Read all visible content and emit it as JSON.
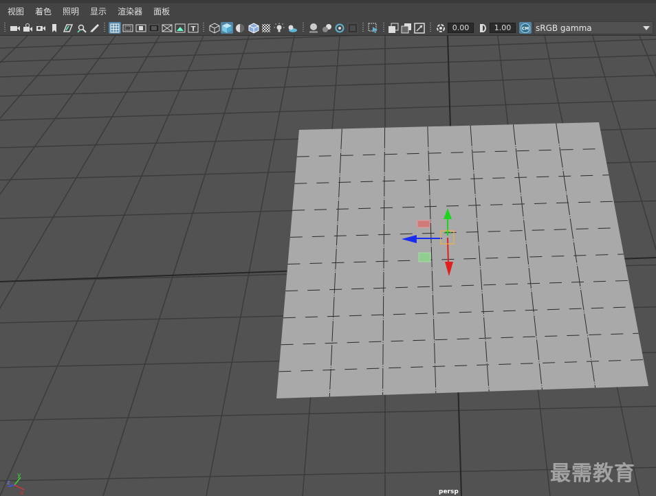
{
  "menu": [
    "视图",
    "着色",
    "照明",
    "显示",
    "渲染器",
    "面板"
  ],
  "toolbar": {
    "exposure_value": "0.00",
    "gamma_value": "1.00",
    "colorspace_value": "sRGB gamma",
    "accent_color": "#5fb3d3",
    "icons": [
      "select-camera-icon",
      "camera-attributes-icon",
      "bookmark-icon",
      "image-plane-icon",
      "2d-pan-zoom-icon",
      "grease-pencil-icon",
      "grid-icon",
      "film-gate-icon",
      "resolution-gate-icon",
      "gate-mask-icon",
      "field-chart-icon",
      "safe-action-icon",
      "safe-title-icon",
      "wireframe-icon",
      "smooth-shade-icon",
      "use-default-material-icon",
      "wireframe-on-shaded-icon",
      "xray-icon",
      "use-all-lights-icon",
      "shadows-icon",
      "screen-space-ao-icon",
      "motion-blur-icon",
      "multisample-aa-icon",
      "depth-of-field-icon",
      "isolate-select-icon",
      "xray-joints-icon",
      "xray-active-icon",
      "backface-culling-icon",
      "exposure-icon",
      "gamma-icon",
      "color-management-icon"
    ]
  },
  "viewport": {
    "camera_label": "persp",
    "axis_labels": {
      "x": "x",
      "y": "y",
      "z": "z"
    },
    "background_color": "#525252",
    "grid_color": "#3b3b3b",
    "plane_color": "#a9a9a9"
  },
  "watermark": "最需教育"
}
